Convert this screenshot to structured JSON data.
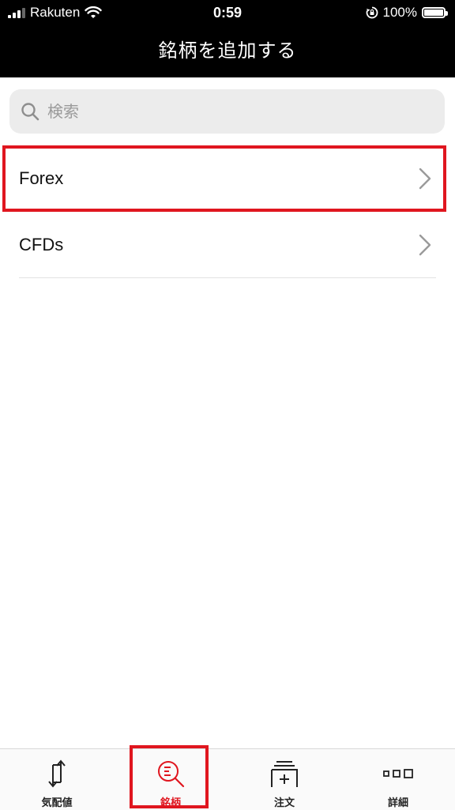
{
  "status_bar": {
    "carrier": "Rakuten",
    "time": "0:59",
    "battery": "100%",
    "icons": [
      "signal-icon",
      "wifi-icon",
      "rotation-lock-icon",
      "battery-icon"
    ]
  },
  "nav": {
    "title": "銘柄を追加する"
  },
  "search": {
    "placeholder": "検索",
    "value": ""
  },
  "list": {
    "items": [
      {
        "label": "Forex",
        "icon": "chevron-right-icon",
        "highlighted": true
      },
      {
        "label": "CFDs",
        "icon": "chevron-right-icon",
        "highlighted": false
      }
    ]
  },
  "tabbar": {
    "tabs": [
      {
        "label": "気配値",
        "icon": "quotes-arrows-icon",
        "active": false
      },
      {
        "label": "銘柄",
        "icon": "symbol-search-icon",
        "active": true
      },
      {
        "label": "注文",
        "icon": "order-add-icon",
        "active": false
      },
      {
        "label": "詳細",
        "icon": "more-squares-icon",
        "active": false
      }
    ]
  },
  "colors": {
    "accent": "#e0161f",
    "topbar": "#000000",
    "search_bg": "#ececec"
  }
}
